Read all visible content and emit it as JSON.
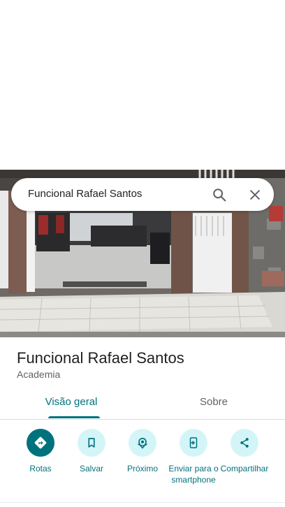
{
  "search": {
    "query": "Funcional Rafael Santos"
  },
  "place": {
    "name": "Funcional Rafael Santos",
    "category": "Academia"
  },
  "tabs": [
    {
      "label": "Visão geral",
      "active": true
    },
    {
      "label": "Sobre",
      "active": false
    }
  ],
  "actions": [
    {
      "label": "Rotas",
      "icon": "directions-icon"
    },
    {
      "label": "Salvar",
      "icon": "bookmark-icon"
    },
    {
      "label": "Próximo",
      "icon": "nearby-icon"
    },
    {
      "label": "Enviar para o smartphone",
      "icon": "send-to-phone-icon"
    },
    {
      "label": "Compartilhar",
      "icon": "share-icon"
    }
  ],
  "colors": {
    "accent": "#00727d",
    "accent_light": "#d4f5f8",
    "text_primary": "#202124",
    "text_secondary": "#5f6368"
  }
}
